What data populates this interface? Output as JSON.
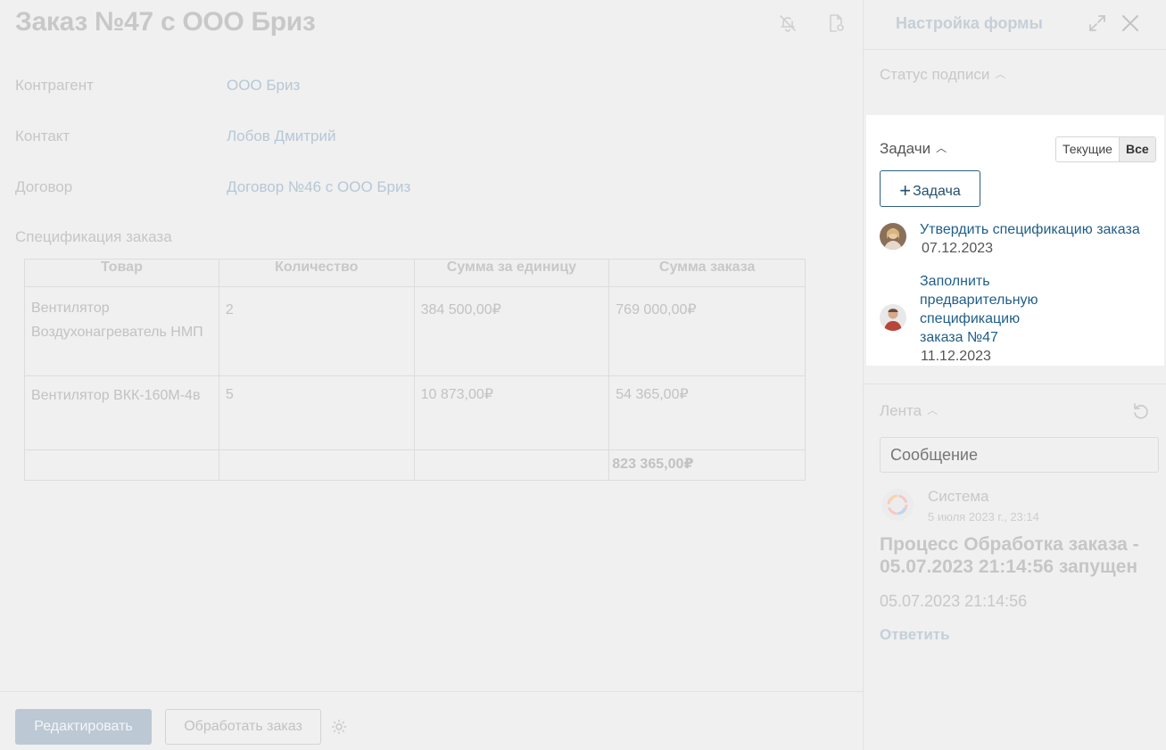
{
  "header": {
    "title": "Заказ №47 с ООО Бриз",
    "icons": [
      "bell-off-icon",
      "document-settings-icon"
    ]
  },
  "fields": [
    {
      "label": "Контрагент",
      "value": "ООО Бриз"
    },
    {
      "label": "Контакт",
      "value": "Лобов Дмитрий"
    },
    {
      "label": "Договор",
      "value": "Договор №46 с ООО Бриз"
    }
  ],
  "spec": {
    "title": "Спецификация заказа",
    "columns": [
      "Товар",
      "Количество",
      "Сумма за единицу",
      "Сумма заказа"
    ],
    "rows": [
      {
        "product": "Вентилятор Воздухонагреватель НМП",
        "qty": "2",
        "unit_price": "384 500,00₽",
        "total": "769 000,00₽"
      },
      {
        "product": "Вентилятор ВКК-160М-4в",
        "qty": "5",
        "unit_price": "10 873,00₽",
        "total": "54 365,00₽"
      }
    ],
    "grand_total": "823 365,00₽"
  },
  "footer": {
    "edit_label": "Редактировать",
    "process_label": "Обработать заказ"
  },
  "side": {
    "title": "Настройка формы",
    "signature_status": "Статус подписи",
    "tasks": {
      "label": "Задачи",
      "filter_current": "Текущие",
      "filter_all": "Все",
      "add_label": "Задача",
      "items": [
        {
          "title": "Утвердить спецификацию заказа",
          "date": "07.12.2023"
        },
        {
          "title_lines": [
            "Заполнить",
            "предварительную",
            "спецификацию",
            "заказа №47"
          ],
          "date": "11.12.2023"
        }
      ]
    },
    "feed": {
      "label": "Лента",
      "message_placeholder": "Сообщение",
      "author": "Система",
      "author_date": "5 июля 2023 г., 23:14",
      "event_title": "Процесс Обработка заказа - 05.07.2023 21:14:56 запущен",
      "event_time": "05.07.2023 21:14:56",
      "reply_label": "Ответить"
    }
  },
  "colors": {
    "link": "#1f5e89",
    "button_outline": "#2e5f82",
    "dim_overlay": "#f0f0f0"
  }
}
